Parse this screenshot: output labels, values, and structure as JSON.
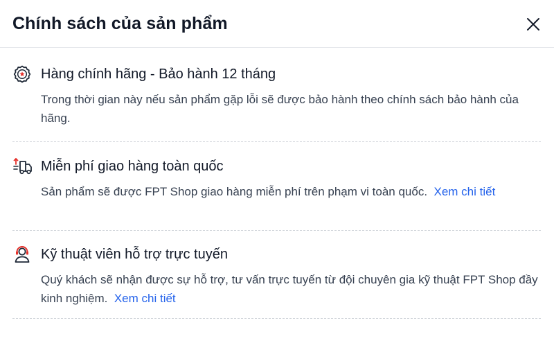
{
  "modal": {
    "title": "Chính sách của sản phẩm",
    "close_icon": "close-icon"
  },
  "policies": [
    {
      "icon": "badge-star-icon",
      "title": "Hàng chính hãng - Bảo hành 12 tháng",
      "description": "Trong thời gian này nếu sản phẩm gặp lỗi sẽ được bảo hành theo chính sách bảo hành của hãng.",
      "link": ""
    },
    {
      "icon": "delivery-truck-icon",
      "title": "Miễn phí giao hàng toàn quốc",
      "description": "Sản phẩm sẽ được FPT Shop giao hàng miễn phí trên phạm vi toàn quốc.",
      "link": "Xem chi tiết"
    },
    {
      "icon": "support-agent-icon",
      "title": "Kỹ thuật viên hỗ trợ trực tuyến",
      "description": "Quý khách sẽ nhận được sự hỗ trợ, tư vấn trực tuyến từ đội chuyên gia kỹ thuật FPT Shop đầy kinh nghiệm.",
      "link": "Xem chi tiết"
    }
  ],
  "colors": {
    "accent_red": "#e5312b",
    "link_blue": "#2563eb"
  }
}
